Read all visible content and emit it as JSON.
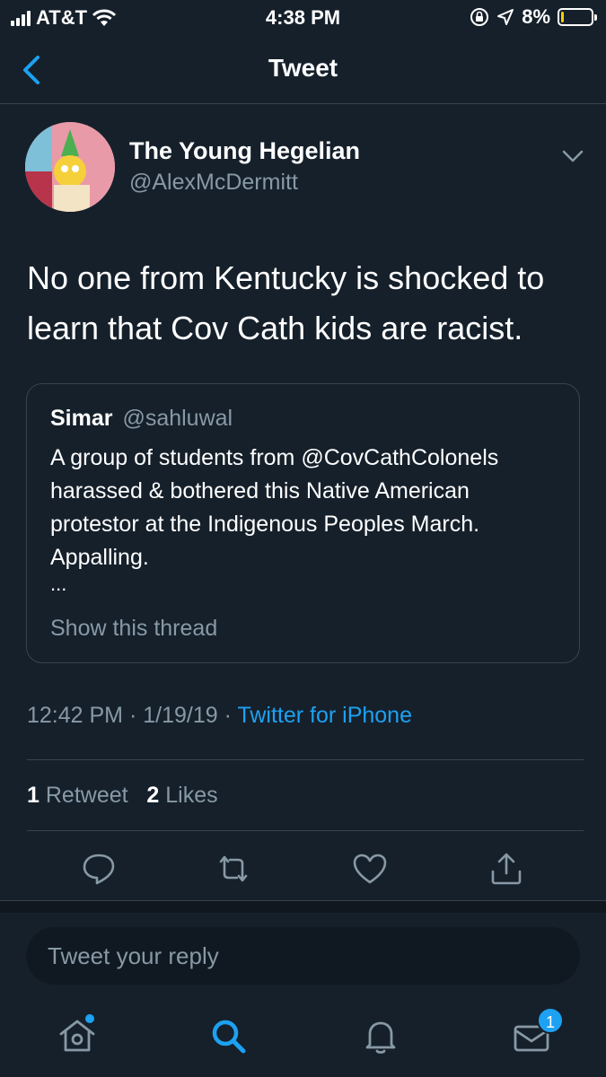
{
  "status_bar": {
    "carrier": "AT&T",
    "time": "4:38 PM",
    "battery_percent": "8%",
    "battery_level": 0.08,
    "battery_color": "#ffcc00"
  },
  "nav": {
    "title": "Tweet"
  },
  "tweet": {
    "author_name": "The Young Hegelian",
    "author_handle": "@AlexMcDermitt",
    "text": "No one from Kentucky is shocked to learn that Cov Cath kids are racist.",
    "quote": {
      "name": "Simar",
      "handle": "@sahluwal",
      "text": "A group of students from @CovCathColonels harassed & bothered this Native American protestor at the Indigenous Peoples March. Appalling.",
      "ellipsis": "...",
      "show_thread": "Show this thread"
    },
    "time": "12:42 PM",
    "date": "1/19/19",
    "separator": "·",
    "source": "Twitter for iPhone",
    "retweet_count": "1",
    "retweet_label": "Retweet",
    "like_count": "2",
    "like_label": "Likes"
  },
  "reply": {
    "placeholder": "Tweet your reply"
  },
  "tab_bar": {
    "messages_badge": "1"
  },
  "colors": {
    "background": "#15202b",
    "accent": "#1da1f2",
    "secondary_text": "#8899a6",
    "border": "#38444d"
  }
}
